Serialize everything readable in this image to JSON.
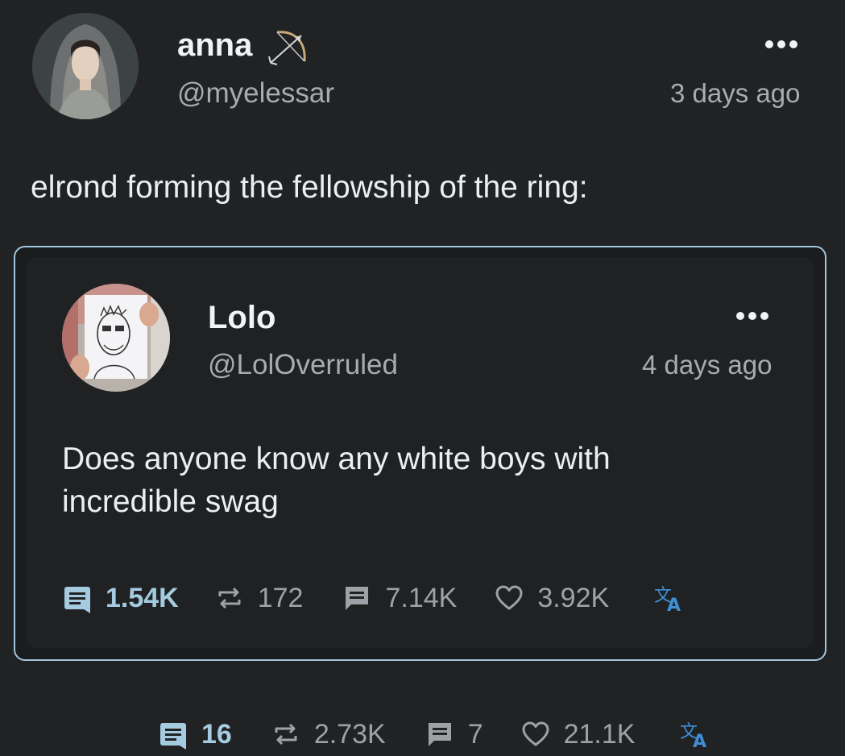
{
  "post": {
    "author": {
      "name": "anna",
      "handle": "@myelessar",
      "name_icon": "bow-and-arrow-icon"
    },
    "time": "3 days ago",
    "text": "elrond forming the fellowship of the ring:",
    "stats": {
      "quotes": "16",
      "reposts": "2.73K",
      "comments": "7",
      "likes": "21.1K"
    }
  },
  "quoted_post": {
    "author": {
      "name": "Lolo",
      "handle": "@LolOverruled"
    },
    "time": "4 days ago",
    "text_line1": "Does anyone know any white boys with",
    "text_line2": "incredible swag",
    "stats": {
      "quotes": "1.54K",
      "reposts": "172",
      "comments": "7.14K",
      "likes": "3.92K"
    }
  },
  "icons": {
    "quote": "quote-icon",
    "repost": "repost-icon",
    "comment": "comment-icon",
    "like": "heart-icon",
    "translate": "translate-icon",
    "more": "more-options-icon"
  },
  "colors": {
    "background": "#212224",
    "accent": "#a4cbe0",
    "card_border": "#9fc6db",
    "muted_text": "#a9abaf",
    "translate_blue": "#3f8fd6"
  }
}
